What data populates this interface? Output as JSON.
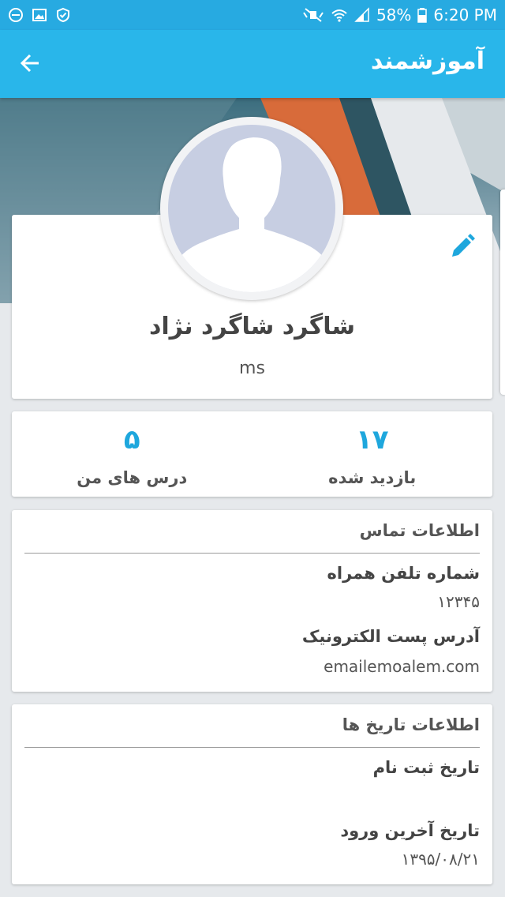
{
  "status_bar": {
    "battery": "58%",
    "time": "6:20 PM"
  },
  "app_bar": {
    "title": "آموزشمند",
    "back_icon": "arrow-left-icon"
  },
  "profile": {
    "name": "شاگرد شاگرد نژاد",
    "username": "ms",
    "edit_icon": "pencil-icon"
  },
  "stats": [
    {
      "value": "۱۷",
      "label": "بازدید شده"
    },
    {
      "value": "۵",
      "label": "درس های من"
    }
  ],
  "contact": {
    "title": "اطلاعات تماس",
    "phone_label": "شماره تلفن همراه",
    "phone_value": "۱۲۳۴۵",
    "email_label": "آدرس پست الکترونیک",
    "email_value": "emailemoalem.com"
  },
  "dates": {
    "title": "اطلاعات تاریخ ها",
    "registration_label": "تاریخ ثبت نام",
    "registration_value": "",
    "last_login_label": "تاریخ آخرین ورود",
    "last_login_value": "۱۳۹۵/۰۸/۲۱"
  },
  "colors": {
    "app_bar": "#29b6ea",
    "accent": "#1ea7dd"
  }
}
